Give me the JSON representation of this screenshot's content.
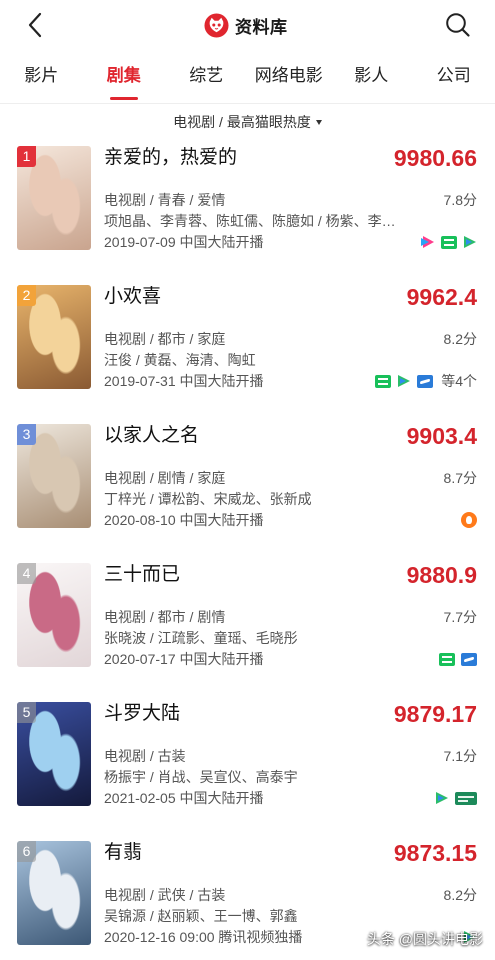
{
  "header": {
    "title": "资料库",
    "back_icon": "back-arrow-icon",
    "logo_icon": "maoyan-cat-logo-icon",
    "search_icon": "search-icon",
    "accent_color": "#e0262f"
  },
  "tabs": [
    {
      "label": "影片",
      "active": false
    },
    {
      "label": "剧集",
      "active": true
    },
    {
      "label": "综艺",
      "active": false
    },
    {
      "label": "网络电影",
      "active": false
    },
    {
      "label": "影人",
      "active": false
    },
    {
      "label": "公司",
      "active": false
    }
  ],
  "filter": {
    "label": "电视剧 / 最高猫眼热度",
    "icon": "caret-down-icon"
  },
  "list": [
    {
      "rank": "1",
      "badge_color": "#e2313a",
      "poster_colors": [
        "#f5e7dc",
        "#c9a48e",
        "#e9c9b6"
      ],
      "title": "亲爱的，热爱的",
      "score": "9980.66",
      "genres": "电视剧 / 青春 / 爱情",
      "rating": "7.8分",
      "cast": "项旭晶、李青蓉、陈虹儒、陈臆如 / 杨紫、李…",
      "release": "2019-07-09 中国大陆开播",
      "platforms": [
        "youku-icon",
        "iqiyi-icon",
        "tencent-video-icon"
      ],
      "platform_more": ""
    },
    {
      "rank": "2",
      "badge_color": "#f2a33a",
      "poster_colors": [
        "#e9b56c",
        "#8a5a33",
        "#f3d39a"
      ],
      "title": "小欢喜",
      "score": "9962.4",
      "genres": "电视剧 / 都市 / 家庭",
      "rating": "8.2分",
      "cast": "汪俊 / 黄磊、海清、陶虹",
      "release": "2019-07-31 中国大陆开播",
      "platforms": [
        "iqiyi-icon",
        "tencent-video-icon",
        "cctv-icon"
      ],
      "platform_more": "等4个"
    },
    {
      "rank": "3",
      "badge_color": "#6f8fd8",
      "poster_colors": [
        "#eee7dd",
        "#a88e74",
        "#d8c7b2"
      ],
      "title": "以家人之名",
      "score": "9903.4",
      "genres": "电视剧 / 剧情 / 家庭",
      "rating": "8.7分",
      "cast": "丁梓光 / 谭松韵、宋威龙、张新成",
      "release": "2020-08-10 中国大陆开播",
      "platforms": [
        "mango-tv-icon"
      ],
      "platform_more": ""
    },
    {
      "rank": "4",
      "badge_color": "rgba(150,150,150,0.6)",
      "poster_colors": [
        "#faf7f7",
        "#e2d6d8",
        "#c96a86"
      ],
      "title": "三十而已",
      "score": "9880.9",
      "genres": "电视剧 / 都市 / 剧情",
      "rating": "7.7分",
      "cast": "张晓波 / 江疏影、童瑶、毛晓彤",
      "release": "2020-07-17 中国大陆开播",
      "platforms": [
        "iqiyi-icon",
        "cctv-icon"
      ],
      "platform_more": ""
    },
    {
      "rank": "5",
      "badge_color": "rgba(150,150,150,0.6)",
      "poster_colors": [
        "#3a4fa0",
        "#141a3c",
        "#9fd0f0"
      ],
      "title": "斗罗大陆",
      "score": "9879.17",
      "genres": "电视剧 / 古装",
      "rating": "7.1分",
      "cast": "杨振宇 / 肖战、吴宣仪、高泰宇",
      "release": "2021-02-05 中国大陆开播",
      "platforms": [
        "tencent-video-icon",
        "other-platform-icon"
      ],
      "platform_more": ""
    },
    {
      "rank": "6",
      "badge_color": "rgba(150,150,150,0.6)",
      "poster_colors": [
        "#a9c4de",
        "#3d5876",
        "#e9eef4"
      ],
      "title": "有翡",
      "score": "9873.15",
      "genres": "电视剧 / 武侠 / 古装",
      "rating": "8.2分",
      "cast": "吴锦源 / 赵丽颖、王一博、郭鑫",
      "release": "2020-12-16 09:00 腾讯视频独播",
      "platforms": [
        "tencent-video-icon"
      ],
      "platform_more": ""
    }
  ],
  "watermark": "头条 @圆头讲电影"
}
